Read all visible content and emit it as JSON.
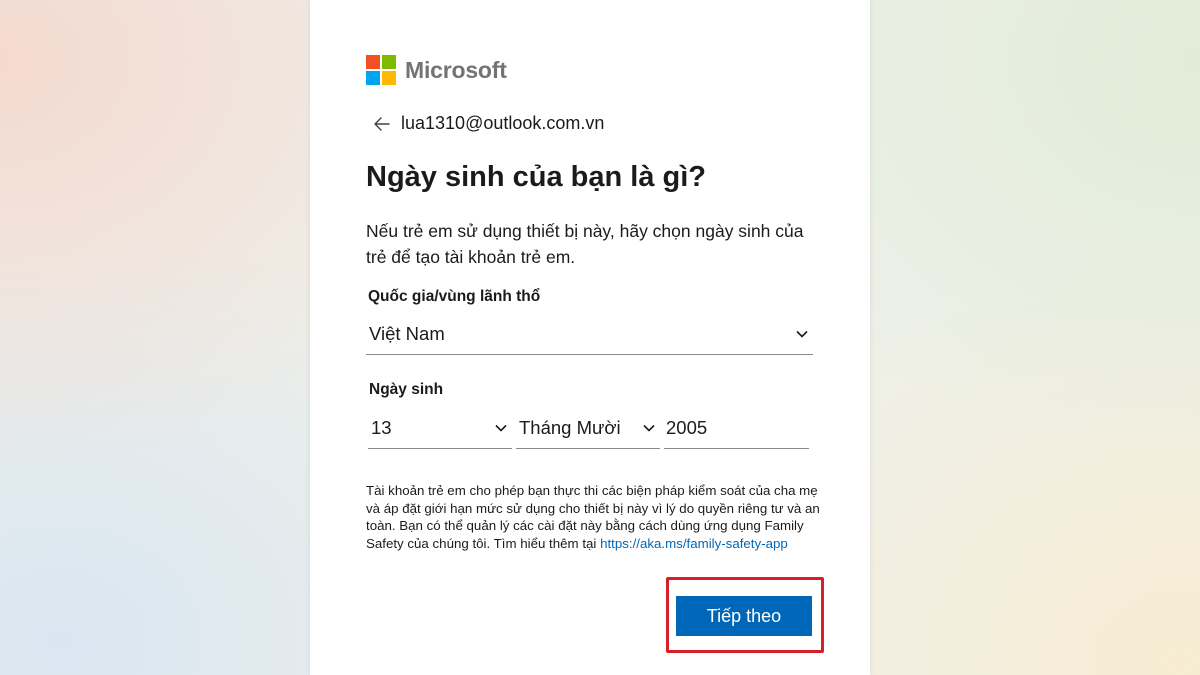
{
  "brand": {
    "name": "Microsoft",
    "logo_colors": [
      "#f25022",
      "#7fba00",
      "#00a4ef",
      "#ffb900"
    ]
  },
  "identity": {
    "email": "lua1310@outlook.com.vn",
    "back_icon": "arrow-left-icon"
  },
  "page": {
    "title": "Ngày sinh của bạn là gì?",
    "description": "Nếu trẻ em sử dụng thiết bị này, hãy chọn ngày sinh của trẻ để tạo tài khoản trẻ em."
  },
  "country": {
    "label": "Quốc gia/vùng lãnh thổ",
    "selected": "Việt Nam"
  },
  "birthdate": {
    "label": "Ngày sinh",
    "day": "13",
    "month": "Tháng Mười",
    "year": "2005"
  },
  "note": {
    "text": "Tài khoản trẻ em cho phép bạn thực thi các biện pháp kiểm soát của cha mẹ và áp đặt giới hạn mức sử dụng cho thiết bị này vì lý do quyền riêng tư và an toàn. Bạn có thể quản lý các cài đặt này bằng cách dùng ứng dụng Family Safety của chúng tôi. Tìm hiểu thêm tại ",
    "link": "https://aka.ms/family-safety-app"
  },
  "actions": {
    "next_label": "Tiếp theo",
    "accent": "#0067b8",
    "highlight_color": "#d81f26"
  }
}
